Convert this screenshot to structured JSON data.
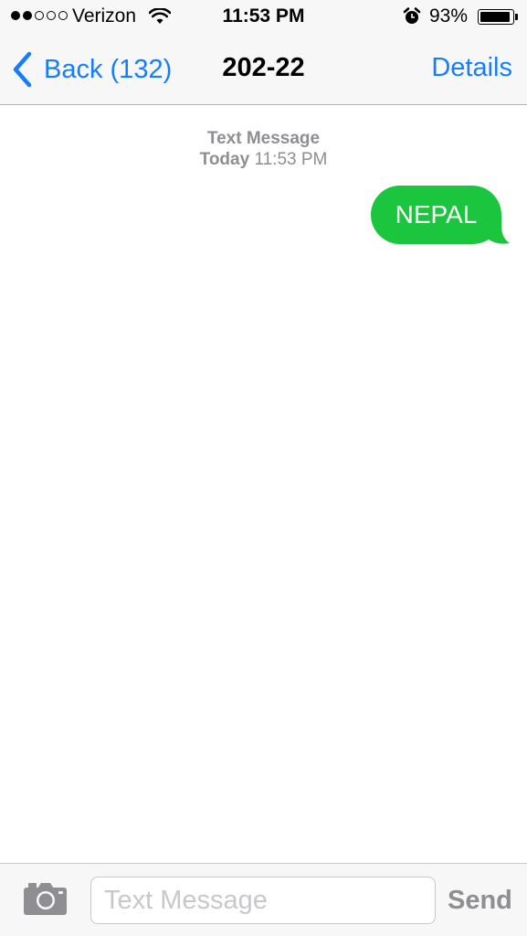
{
  "status_bar": {
    "carrier": "Verizon",
    "signal_bars_filled": 2,
    "signal_bars_total": 5,
    "time": "11:53 PM",
    "battery_percent": "93%",
    "battery_level": 0.93,
    "icons": [
      "signal-icon",
      "wifi-icon",
      "alarm-icon",
      "battery-icon"
    ]
  },
  "nav": {
    "back_label": "Back (132)",
    "title": "202-22",
    "details_label": "Details",
    "accent_color": "#157efb"
  },
  "conversation": {
    "service_label": "Text Message",
    "date_label": "Today",
    "time_label": "11:53 PM",
    "messages": [
      {
        "direction": "sent",
        "text": "NEPAL",
        "bubble_color": "#1bc63e"
      }
    ]
  },
  "input_bar": {
    "camera_icon": "camera-icon",
    "placeholder": "Text Message",
    "value": "",
    "send_label": "Send"
  }
}
